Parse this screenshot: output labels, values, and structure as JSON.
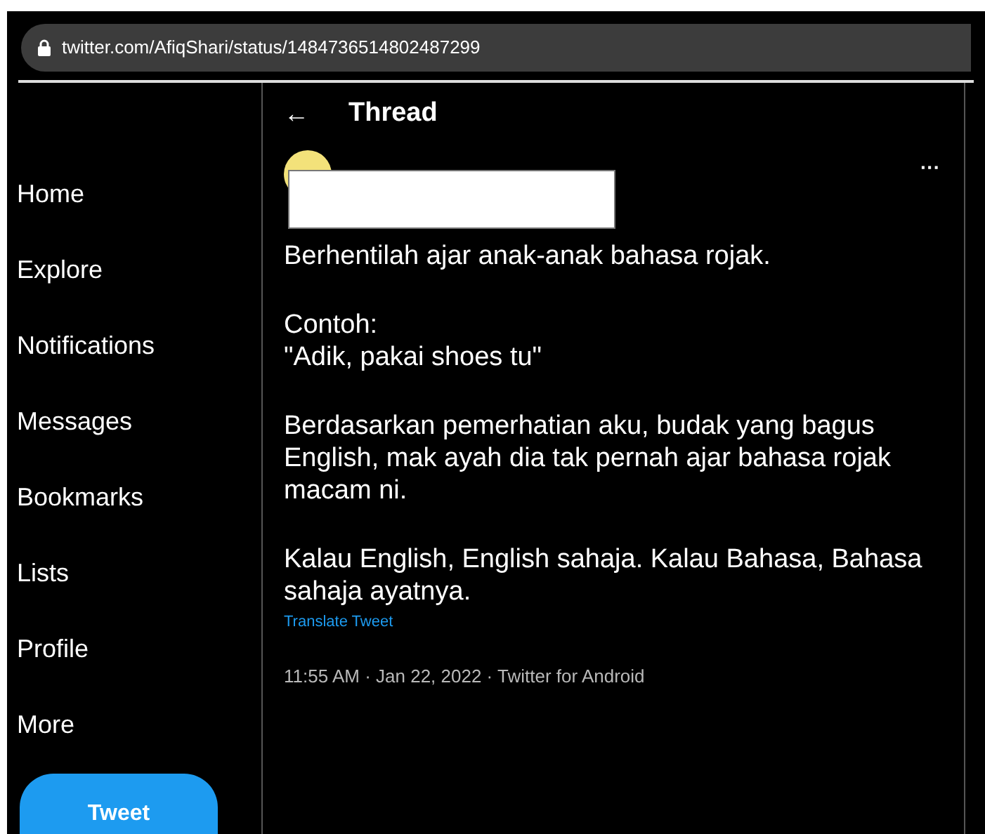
{
  "address_bar": {
    "url": "twitter.com/AfiqShari/status/1484736514802487299"
  },
  "sidebar": {
    "items": [
      {
        "label": "Home"
      },
      {
        "label": "Explore"
      },
      {
        "label": "Notifications"
      },
      {
        "label": "Messages"
      },
      {
        "label": "Bookmarks"
      },
      {
        "label": "Lists"
      },
      {
        "label": "Profile"
      },
      {
        "label": "More"
      }
    ],
    "tweet_button": "Tweet"
  },
  "header": {
    "back": "←",
    "title": "Thread"
  },
  "tweet": {
    "more": "···",
    "paragraphs": [
      "Berhentilah ajar anak-anak bahasa rojak.",
      "Contoh:\n\"Adik, pakai shoes tu\"",
      "Berdasarkan pemerhatian aku, budak yang bagus English, mak ayah dia tak pernah ajar bahasa rojak macam ni.",
      "Kalau English, English sahaja. Kalau Bahasa, Bahasa sahaja ayatnya."
    ],
    "translate": "Translate Tweet",
    "meta": "11:55 AM · Jan 22, 2022 · Twitter for Android"
  }
}
